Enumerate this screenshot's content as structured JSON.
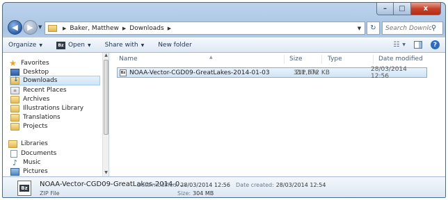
{
  "window": {
    "caption": {
      "minimize": "–",
      "maximize": "□",
      "close": "x"
    }
  },
  "address": {
    "crumbs": [
      "Baker, Matthew",
      "Downloads"
    ],
    "search_placeholder": "Search Downloads"
  },
  "toolbar": {
    "organize": "Organize",
    "open": "Open",
    "share_with": "Share with",
    "new_folder": "New folder"
  },
  "nav": {
    "favorites": "Favorites",
    "favorite_items": [
      "Desktop",
      "Downloads",
      "Recent Places",
      "Archives",
      "Illustrations Library",
      "Translations",
      "Projects"
    ],
    "libraries": "Libraries",
    "library_items": [
      "Documents",
      "Music",
      "Pictures"
    ]
  },
  "columns": {
    "name": "Name",
    "size": "Size",
    "type": "Type",
    "date_modified": "Date modified"
  },
  "files": [
    {
      "name": "NOAA-Vector-CGD09-GreatLakes-2014-01-03",
      "size": "311,372 KB",
      "type": "ZIP File",
      "date_modified": "28/03/2014 12:56"
    }
  ],
  "details": {
    "name": "NOAA-Vector-CGD09-GreatLakes-2014-0...",
    "type": "ZIP File",
    "modified_label": "Date modified:",
    "modified_value": "28/03/2014 12:56",
    "size_label": "Size:",
    "size_value": "304 MB",
    "created_label": "Date created:",
    "created_value": "28/03/2014 12:54"
  }
}
